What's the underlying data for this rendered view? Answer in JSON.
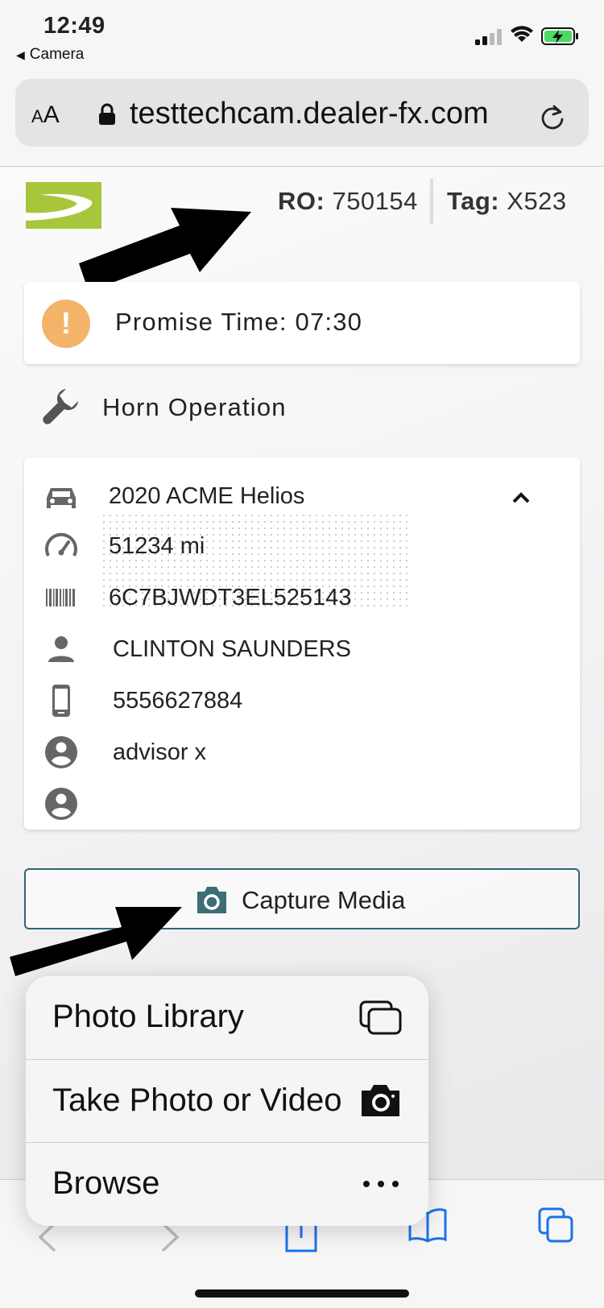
{
  "status_bar": {
    "time": "12:49",
    "back_label": "Camera"
  },
  "browser": {
    "text_size_label_small": "A",
    "text_size_label_big": "A",
    "url": "testtechcam.dealer-fx.com"
  },
  "header": {
    "ro_label": "RO:",
    "ro_value": "750154",
    "tag_label": "Tag:",
    "tag_value": "X523"
  },
  "promise": {
    "text": "Promise Time: 07:30",
    "icon": "!"
  },
  "operation": {
    "name": "Horn Operation"
  },
  "vehicle": {
    "model": "2020 ACME Helios",
    "mileage": "51234 mi",
    "vin": "6C7BJWDT3EL525143",
    "customer_name": "CLINTON SAUNDERS",
    "phone": "5556627884",
    "advisor": "advisor x",
    "technician": ""
  },
  "capture": {
    "label": "Capture Media"
  },
  "menu": {
    "items": [
      {
        "label": "Photo Library",
        "icon": "photo-library-icon"
      },
      {
        "label": "Take Photo or Video",
        "icon": "camera-icon"
      },
      {
        "label": "Browse",
        "icon": "ellipsis-icon"
      }
    ]
  },
  "colors": {
    "accent_green": "#a8c63c",
    "warning": "#f3b46a",
    "teal": "#3d6e73",
    "ios_blue": "#1a73e8"
  }
}
